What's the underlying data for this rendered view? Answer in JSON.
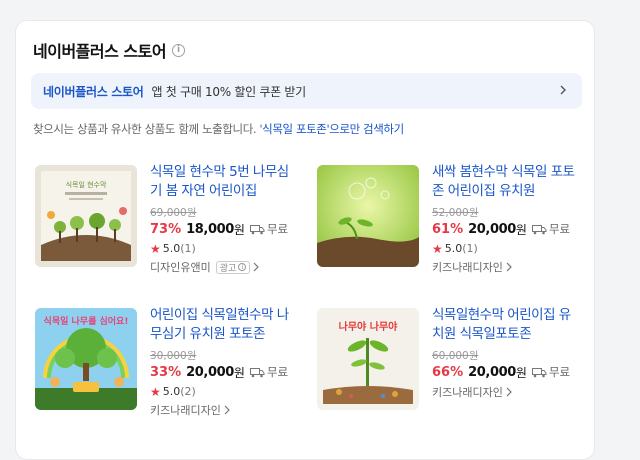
{
  "section": {
    "title": "네이버플러스 스토어",
    "banner": {
      "brand": "네이버플러스 스토어",
      "text": "앱 첫 구매 10% 할인 쿠폰 받기"
    },
    "notice": {
      "prefix": "찾으시는 상품과 유사한 상품도 함께 노출합니다. '",
      "link": "식목일 포토존",
      "suffix": "'으로만 검색하기"
    }
  },
  "products": [
    {
      "name": "식목일 현수막 5번 나무심기 봄 자연 어린이집",
      "original_price": "69,000원",
      "discount": "73%",
      "price": "18,000",
      "won": "원",
      "shipping": "무료",
      "rating": "5.0",
      "reviews": "(1)",
      "seller": "디자인유앤미",
      "ad": "광고",
      "thumb_text": "식목일 현수막"
    },
    {
      "name": "새싹 봄현수막 식목일 포토존 어린이집 유치원",
      "original_price": "52,000원",
      "discount": "61%",
      "price": "20,000",
      "won": "원",
      "shipping": "무료",
      "rating": "5.0",
      "reviews": "(1)",
      "seller": "키즈나래디자인",
      "ad": "",
      "thumb_text": ""
    },
    {
      "name": "어린이집 식목일현수막 나무심기 유치원 포토존",
      "original_price": "30,000원",
      "discount": "33%",
      "price": "20,000",
      "won": "원",
      "shipping": "무료",
      "rating": "5.0",
      "reviews": "(2)",
      "seller": "키즈나래디자인",
      "ad": "",
      "thumb_text": "식목일 나무를 심어요!"
    },
    {
      "name": "식목일현수막 어린이집 유치원 식목일포토존",
      "original_price": "60,000원",
      "discount": "66%",
      "price": "20,000",
      "won": "원",
      "shipping": "무료",
      "rating": "",
      "reviews": "",
      "seller": "키즈나래디자인",
      "ad": "",
      "thumb_text": "나무야 나무야"
    }
  ],
  "colors": {
    "link": "#1a56c9",
    "discount": "#e63946",
    "banner_bg": "#eff3fb"
  }
}
